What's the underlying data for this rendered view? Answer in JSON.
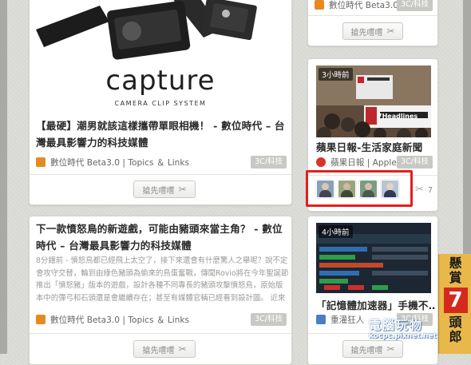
{
  "left_column": {
    "card1": {
      "image_brand": "capture",
      "image_tagline": "CAMERA CLIP SYSTEM",
      "title": "【最硬】潮男就該這樣攜帶單眼相機！ - 數位時代 – 台灣最具影響力的科技媒體",
      "source": "數位時代 Beta3.0 | Topics ＆ Links",
      "category": "3C/科技",
      "grab_label": "搶先嚐嚐"
    },
    "card2": {
      "title": "下一款憤怒鳥的新遊戲，可能由豬頭來當主角？ - 數位時代 – 台灣最具影響力的科技媒體",
      "excerpt": "8分鐘前 - 憤怒鳥都已經飛上太空了，接下來還會有什麼驚人之舉呢？說不定會攻守交替，輪到由綠色豬頭為偷來的鳥蛋奮戰，傳聞Rovio將在今年聖誕節推出「憤怒豬」版本的遊戲，設計各種不同專長的豬頭攻擊憤怒鳥，原始版本中的彈弓和石頭還是會繼續存在；甚至有媒體官稱已經看到設計圖。 近來憤怒鳥也沒",
      "source": "數位時代 Beta3.0 | Topics ＆ Links",
      "category": "3C/科技",
      "grab_label": "搶先嚐嚐"
    }
  },
  "right_column": {
    "top_card": {
      "source": "數位時代 Beta3.0 ...",
      "category": "3C/科技",
      "grab_label": "搶先嚐嚐"
    },
    "card_apple": {
      "time_badge": "3小時前",
      "image_logo": "7Headlines",
      "title": "蘋果日報-生活家庭新聞",
      "source": "蘋果日報 | Apple ...",
      "category": "3C/科技",
      "avatar_count": "7"
    },
    "card_memory": {
      "time_badge": "4小時前",
      "title": "「記憶體加速器」手機不…",
      "source": "重灌狂人",
      "category": "3C/科技",
      "grab_label": "搶先嚐嚐"
    }
  },
  "side_badge": {
    "line1": "懸",
    "line2": "賞",
    "number": "7",
    "line3": "頭",
    "line4": "郎"
  },
  "watermark": {
    "line1": "電腦玩物",
    "line2": "kocpc.pixnet.net"
  },
  "colors": {
    "highlight_box": "#e02020",
    "badge_gold": "#e8b84a",
    "badge_red": "#d42a1e"
  }
}
